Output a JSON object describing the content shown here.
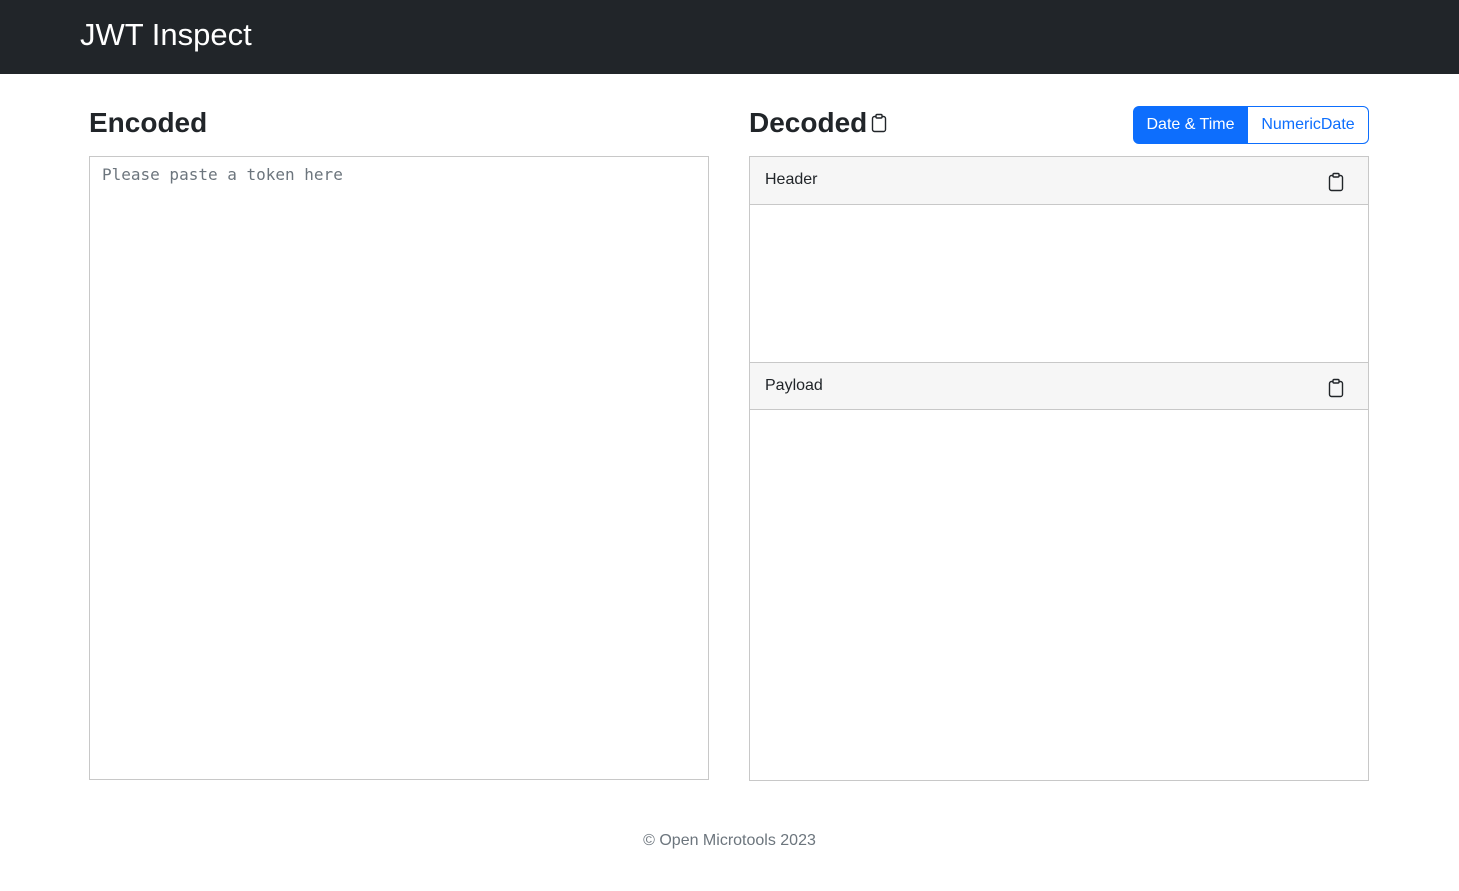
{
  "app": {
    "title": "JWT Inspect"
  },
  "encoded": {
    "title": "Encoded",
    "token_value": "",
    "placeholder": "Please paste a token here"
  },
  "decoded": {
    "title": "Decoded",
    "copy_icon": "clipboard-icon",
    "date_format_toggle": {
      "options": [
        "Date & Time",
        "NumericDate"
      ],
      "selected": "Date & Time"
    },
    "panels": [
      {
        "label": "Header",
        "content": "",
        "copy_icon": "clipboard-icon"
      },
      {
        "label": "Payload",
        "content": "",
        "copy_icon": "clipboard-icon"
      }
    ]
  },
  "footer": {
    "text": "© Open Microtools 2023"
  },
  "colors": {
    "navbar_bg": "#212529",
    "accent": "#0d6efd",
    "panel_header_bg": "#f6f6f6",
    "border": "#c8c8c8",
    "muted_text": "#6c757d"
  }
}
